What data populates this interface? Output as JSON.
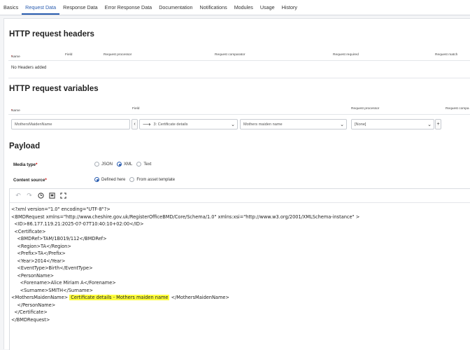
{
  "tabs": [
    "Basics",
    "Request Data",
    "Response Data",
    "Error Response Data",
    "Documentation",
    "Notifications",
    "Modules",
    "Usage",
    "History"
  ],
  "active_tab": "Request Data",
  "headers_section": {
    "title": "HTTP request headers",
    "columns": {
      "name": "Name",
      "field": "Field",
      "processor": "Request processor",
      "comparator": "Request comparator",
      "required": "Request required",
      "match": "Request match"
    },
    "required_mark": "*",
    "empty": "No Headers added"
  },
  "variables_section": {
    "title": "HTTP request variables",
    "columns": {
      "name": "Name",
      "field": "Field",
      "processor": "Request processor",
      "comparator": "Request compa"
    },
    "row": {
      "name_placeholder": "MothersMaidenName",
      "field_path": "3: Certificate details",
      "field_value": "Mothers maiden name",
      "processor": "[None]",
      "add_symbol": "+"
    }
  },
  "payload": {
    "title": "Payload",
    "media_type_label": "Media type",
    "media_options": [
      "JSON",
      "XML",
      "Text"
    ],
    "media_selected": "XML",
    "content_source_label": "Content source",
    "source_options": [
      "Defined here",
      "From asset template"
    ],
    "source_selected": "Defined here",
    "required_mark": "*",
    "toolbar_icons": [
      "undo-icon",
      "redo-icon",
      "history-icon",
      "insert-icon",
      "fullscreen-icon"
    ],
    "code_lines": {
      "l1": "<?xml version=\"1.0\" encoding=\"UTF-8\"?>",
      "l2": "<BMDRequest xmlns=\"http://www.cheshire.gov.uk/RegisterOfficeBMD/Core/Schema/1.0\" xmlns:xsi=\"http://www.w3.org/2001/XMLSchema-instance\" >",
      "l3": "  <ID>86.177.119.21:2025-07-07T10:40:10+02:00</ID>",
      "l4": "  <Certificate>",
      "l5": "    <BMDRef>TAM/1B019/112</BMDRef>",
      "l6": "    <Region>TA</Region>",
      "l7": "    <Prefix>TA</Prefix>",
      "l8": "    <Year>2014</Year>",
      "l9": "    <EventType>Birth</EventType>",
      "l10": "    <PersonName>",
      "l11": "      <Forename>Alice Miriam A</Forename>",
      "l12": "      <Surname>SMITH</Surname>",
      "l13_open": "<MothersMaidenName> ",
      "l13_token": "Certificate details - Mothers maiden name",
      "l13_close": " </MothersMaidenName>",
      "l14": "    </PersonName>",
      "l15": "  </Certificate>",
      "l16": "</BMDRequest>"
    },
    "highlight_color": "#ffff3c"
  },
  "colors": {
    "accent": "#2a5db0",
    "required": "#cc0000"
  }
}
